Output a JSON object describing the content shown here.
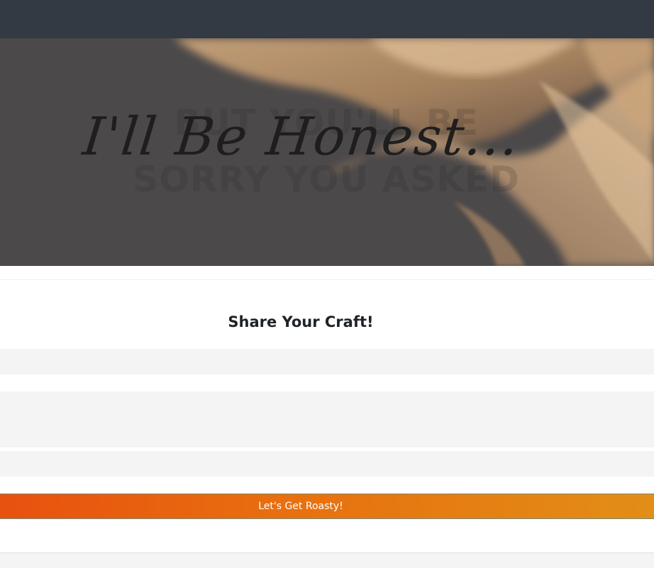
{
  "hero": {
    "headline": "I'll Be Honest...",
    "background_line1": "BUT YOU'LL BE",
    "background_line2": "SORRY YOU ASKED"
  },
  "form": {
    "heading": "Share Your Craft!",
    "submit_label": "Let's Get Roasty!"
  },
  "colors": {
    "navbar": "#343a44",
    "button_start": "#e8510f",
    "button_end": "#e28e18"
  }
}
